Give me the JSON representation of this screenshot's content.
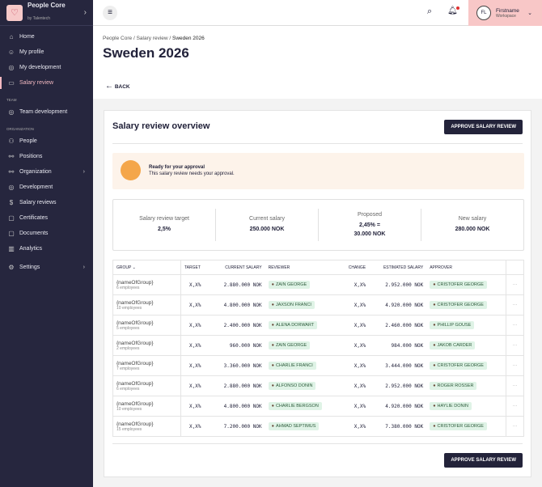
{
  "app": {
    "name": "People Core",
    "sub": "by Talentech"
  },
  "sidebar": {
    "items": [
      {
        "label": "Home",
        "icon": "⌂"
      },
      {
        "label": "My profile",
        "icon": "☺"
      },
      {
        "label": "My development",
        "icon": "◎"
      },
      {
        "label": "Salary review",
        "icon": "▭"
      }
    ],
    "team_label": "TEAM",
    "team": [
      {
        "label": "Team development",
        "icon": "◎"
      }
    ],
    "org_label": "ORGANIZATION",
    "org": [
      {
        "label": "People",
        "icon": "⚇"
      },
      {
        "label": "Positions",
        "icon": "⚯"
      },
      {
        "label": "Organization",
        "icon": "⚯"
      },
      {
        "label": "Development",
        "icon": "◎"
      },
      {
        "label": "Salary reviews",
        "icon": "$"
      },
      {
        "label": "Certificates",
        "icon": "▢"
      },
      {
        "label": "Documents",
        "icon": "▢"
      },
      {
        "label": "Analytics",
        "icon": "▥"
      }
    ],
    "settings": {
      "label": "Settings",
      "icon": "⚙"
    }
  },
  "user": {
    "initials": "FL",
    "name": "Firstname",
    "workspace": "Workspace"
  },
  "breadcrumb": [
    "People Core",
    "Salary review",
    "Sweden 2026"
  ],
  "title": "Sweden 2026",
  "back": "BACK",
  "overview": {
    "title": "Salary review overview",
    "approve": "APPROVE SALARY REVIEW",
    "alert_title": "Ready for your approval",
    "alert_text": "This salary review needs your approval.",
    "stats": [
      {
        "label": "Salary review target",
        "value": "2,5%"
      },
      {
        "label": "Current salary",
        "value": "250.000 NOK"
      },
      {
        "label": "Proposed",
        "value": "2,45% = 30.000 NOK"
      },
      {
        "label": "New salary",
        "value": "280.000 NOK"
      }
    ]
  },
  "table": {
    "headers": [
      "GROUP",
      "TARGET",
      "CURRENT SALARY",
      "REVIEWER",
      "CHANGE",
      "ESTIMATED SALARY",
      "APPROVER"
    ],
    "rows": [
      {
        "group": "{nameOfGroup}",
        "emp": "6 employees",
        "target": "X,X%",
        "current": "2.880.000 NOK",
        "reviewer": "ZAIN GEORGE",
        "change": "X,X%",
        "est": "2.952.000 NOK",
        "approver": "CRISTOFER GEORGE"
      },
      {
        "group": "{nameOfGroup}",
        "emp": "10 employees",
        "target": "X,X%",
        "current": "4.800.000 NOK",
        "reviewer": "JAXSON FRANCI",
        "change": "X,X%",
        "est": "4.920.000 NOK",
        "approver": "CRISTOFER GEORGE"
      },
      {
        "group": "{nameOfGroup}",
        "emp": "5 employees",
        "target": "X,X%",
        "current": "2.400.000 NOK",
        "reviewer": "ALENA DORWART",
        "change": "X,X%",
        "est": "2.460.000 NOK",
        "approver": "PHILLIP GOUSE"
      },
      {
        "group": "{nameOfGroup}",
        "emp": "2 employees",
        "target": "X,X%",
        "current": "960.000 NOK",
        "reviewer": "ZAIN GEORGE",
        "change": "X,X%",
        "est": "984.000 NOK",
        "approver": "JAKOB CARDER"
      },
      {
        "group": "{nameOfGroup}",
        "emp": "7 employees",
        "target": "X,X%",
        "current": "3.360.000 NOK",
        "reviewer": "CHARLIE FRANCI",
        "change": "X,X%",
        "est": "3.444.000 NOK",
        "approver": "CRISTOFER GEORGE"
      },
      {
        "group": "{nameOfGroup}",
        "emp": "6 employees",
        "target": "X,X%",
        "current": "2.880.000 NOK",
        "reviewer": "ALFONSO DONIN",
        "change": "X,X%",
        "est": "2.952.000 NOK",
        "approver": "ROGER ROSSER"
      },
      {
        "group": "{nameOfGroup}",
        "emp": "10 employees",
        "target": "X,X%",
        "current": "4.800.000 NOK",
        "reviewer": "CHARLIE BERGSON",
        "change": "X,X%",
        "est": "4.920.000 NOK",
        "approver": "HAYLIE DONIN"
      },
      {
        "group": "{nameOfGroup}",
        "emp": "15 employees",
        "target": "X,X%",
        "current": "7.200.000 NOK",
        "reviewer": "AHMAD SEPTIMUS",
        "change": "X,X%",
        "est": "7.380.000 NOK",
        "approver": "CRISTOFER GEORGE"
      }
    ]
  },
  "more": "···"
}
